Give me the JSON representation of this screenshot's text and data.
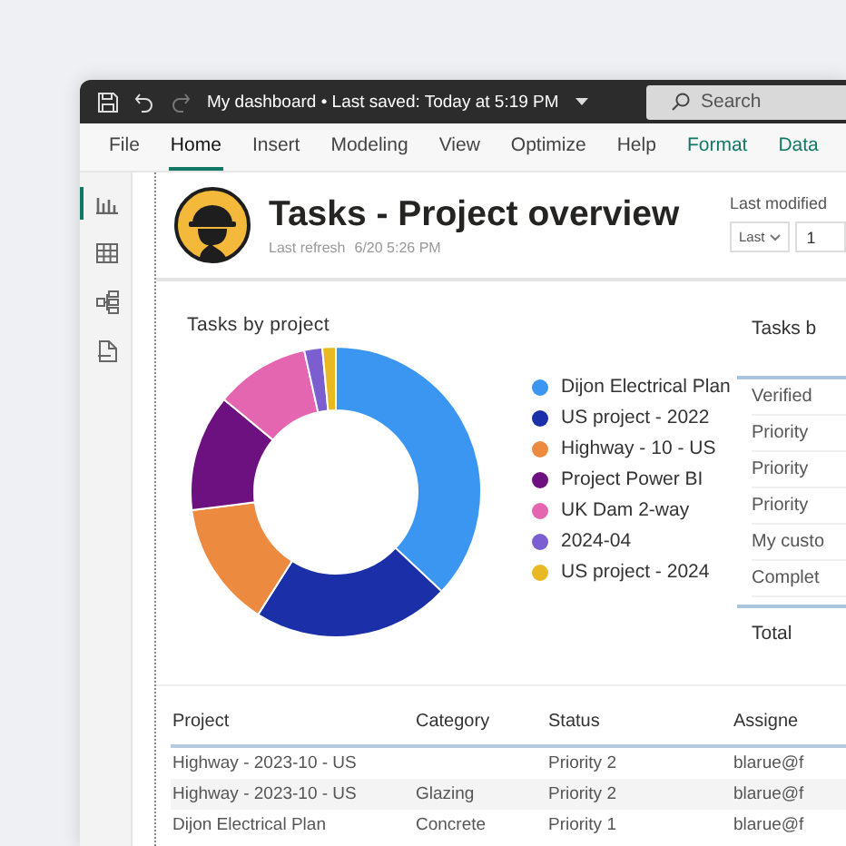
{
  "title_bar": {
    "title": "My dashboard • Last saved: Today at 5:19 PM",
    "search": {
      "placeholder": "Search"
    },
    "redo_disabled": true
  },
  "ribbon_tabs": [
    {
      "label": "File",
      "selected": false,
      "contextual": false
    },
    {
      "label": "Home",
      "selected": true,
      "contextual": false
    },
    {
      "label": "Insert",
      "selected": false,
      "contextual": false
    },
    {
      "label": "Modeling",
      "selected": false,
      "contextual": false
    },
    {
      "label": "View",
      "selected": false,
      "contextual": false
    },
    {
      "label": "Optimize",
      "selected": false,
      "contextual": false
    },
    {
      "label": "Help",
      "selected": false,
      "contextual": false
    },
    {
      "label": "Format",
      "selected": false,
      "contextual": true
    },
    {
      "label": "Data",
      "selected": false,
      "contextual": true
    }
  ],
  "sidebar": {
    "items": [
      {
        "kind": "report",
        "selected": true
      },
      {
        "kind": "table",
        "selected": false
      },
      {
        "kind": "model",
        "selected": false
      },
      {
        "kind": "dax",
        "selected": false
      }
    ]
  },
  "report": {
    "title": "Tasks - Project overview",
    "refresh_label": "Last refresh",
    "refresh_time": "6/20 5:26 PM",
    "slicer": {
      "label": "Last modified",
      "mode": "Last",
      "value": "1"
    }
  },
  "donut_chart": {
    "title": "Tasks by project",
    "legend": [
      {
        "label": "Dijon Electrical Plan",
        "color": "#3a96f0"
      },
      {
        "label": "US project - 2022",
        "color": "#1a2fa8"
      },
      {
        "label": "Highway - 10 - US",
        "color": "#ec8a40"
      },
      {
        "label": "Project Power BI",
        "color": "#6e1180"
      },
      {
        "label": "UK Dam 2-way",
        "color": "#e466b0"
      },
      {
        "label": "2024-04",
        "color": "#7b5fd0"
      },
      {
        "label": "US project - 2024",
        "color": "#e8b923"
      }
    ]
  },
  "status_table": {
    "title": "Tasks b",
    "rows": [
      "Verified",
      "Priority",
      "Priority",
      "Priority",
      "My custo",
      "Complet"
    ],
    "total": "Total"
  },
  "tasks_table": {
    "columns": [
      "Project",
      "Category",
      "Status",
      "Assigne"
    ],
    "rows": [
      [
        "Highway - 2023-10 - US",
        "",
        "Priority 2",
        "blarue@f"
      ],
      [
        "Highway - 2023-10 - US",
        "Glazing",
        "Priority 2",
        "blarue@f"
      ],
      [
        "Dijon Electrical Plan",
        "Concrete",
        "Priority 1",
        "blarue@f"
      ]
    ]
  }
}
